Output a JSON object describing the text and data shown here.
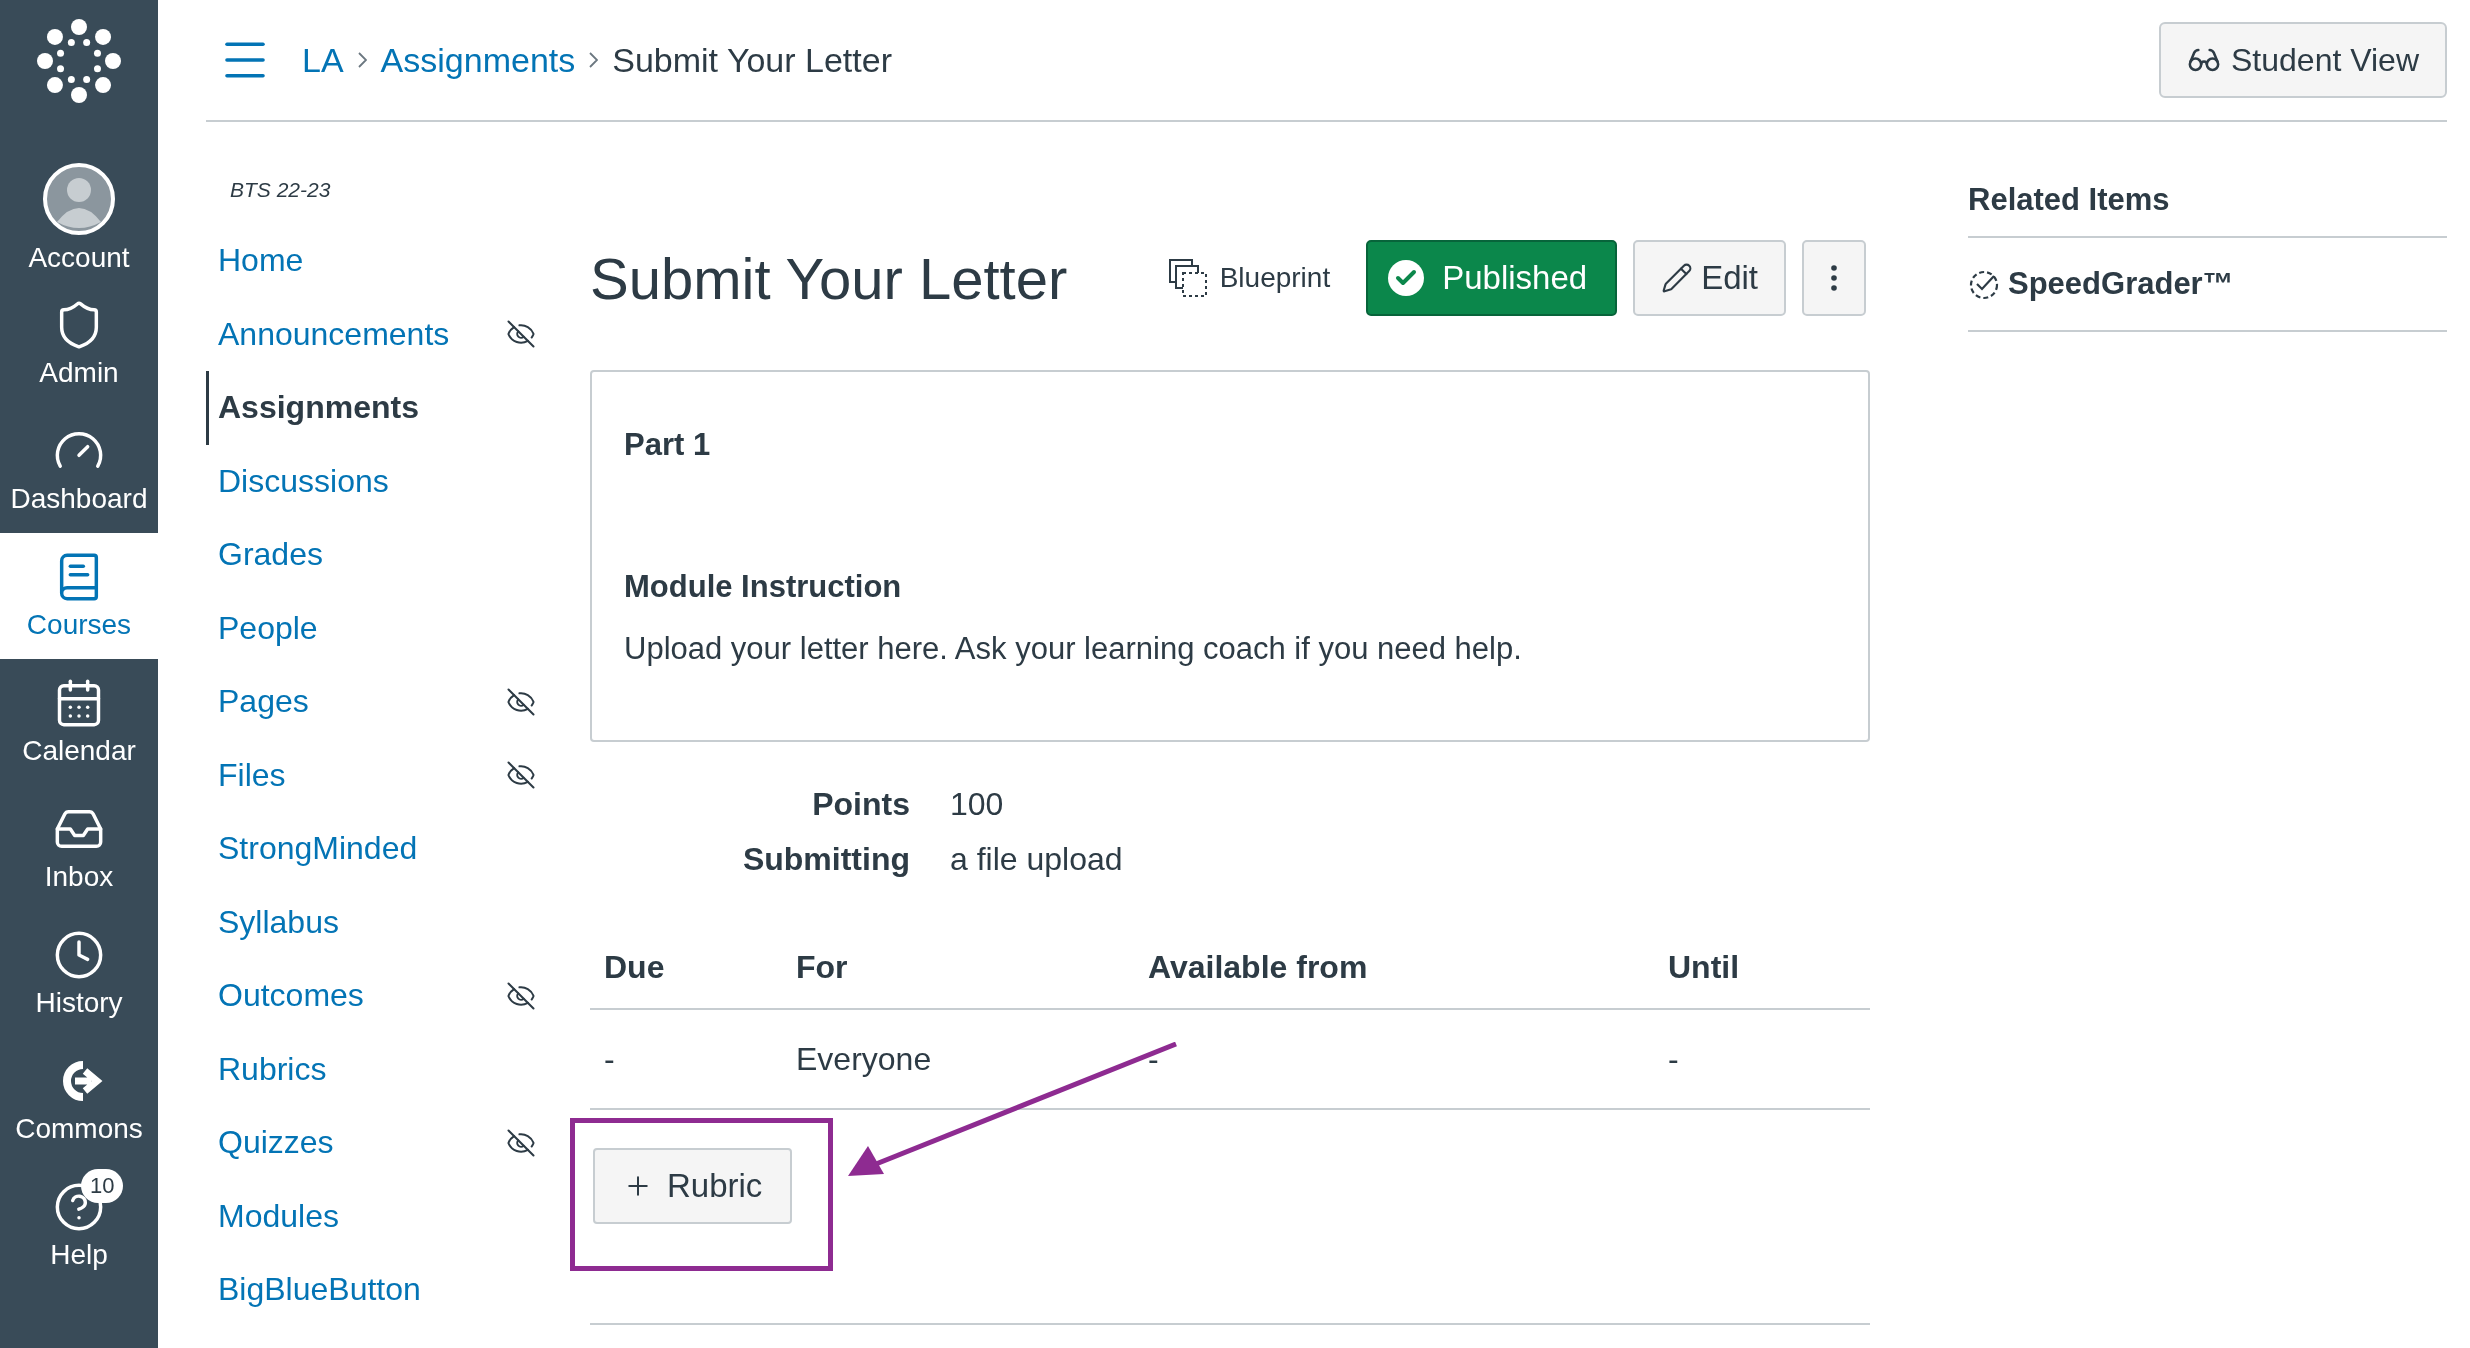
{
  "global_nav": {
    "items": [
      {
        "label": "Account",
        "selected": false
      },
      {
        "label": "Admin",
        "selected": false
      },
      {
        "label": "Dashboard",
        "selected": false
      },
      {
        "label": "Courses",
        "selected": true
      },
      {
        "label": "Calendar",
        "selected": false
      },
      {
        "label": "Inbox",
        "selected": false
      },
      {
        "label": "History",
        "selected": false
      },
      {
        "label": "Commons",
        "selected": false
      },
      {
        "label": "Help",
        "selected": false,
        "badge": "10"
      }
    ]
  },
  "breadcrumb": [
    "LA",
    "Assignments",
    "Submit Your Letter"
  ],
  "student_view_button": "Student View",
  "course_nav": {
    "term": "BTS 22-23",
    "items": [
      {
        "label": "Home",
        "selected": false,
        "hidden": false
      },
      {
        "label": "Announcements",
        "selected": false,
        "hidden": true
      },
      {
        "label": "Assignments",
        "selected": true,
        "hidden": false
      },
      {
        "label": "Discussions",
        "selected": false,
        "hidden": false
      },
      {
        "label": "Grades",
        "selected": false,
        "hidden": false
      },
      {
        "label": "People",
        "selected": false,
        "hidden": false
      },
      {
        "label": "Pages",
        "selected": false,
        "hidden": true
      },
      {
        "label": "Files",
        "selected": false,
        "hidden": true
      },
      {
        "label": "StrongMinded",
        "selected": false,
        "hidden": false
      },
      {
        "label": "Syllabus",
        "selected": false,
        "hidden": false
      },
      {
        "label": "Outcomes",
        "selected": false,
        "hidden": true
      },
      {
        "label": "Rubrics",
        "selected": false,
        "hidden": false
      },
      {
        "label": "Quizzes",
        "selected": false,
        "hidden": true
      },
      {
        "label": "Modules",
        "selected": false,
        "hidden": false
      },
      {
        "label": "BigBlueButton",
        "selected": false,
        "hidden": false
      }
    ]
  },
  "assignment": {
    "title": "Submit Your Letter",
    "blueprint": "Blueprint",
    "publish_button": {
      "label": "Published",
      "published": true
    },
    "edit_button": "Edit",
    "description": {
      "heading": "Part 1",
      "subheading": "Module Instruction",
      "text": "Upload your letter here. Ask your learning coach if you need help."
    },
    "details": [
      {
        "label": "Points",
        "value": "100"
      },
      {
        "label": "Submitting",
        "value": "a file upload"
      }
    ],
    "table": {
      "columns": [
        "Due",
        "For",
        "Available from",
        "Until"
      ],
      "rows": [
        [
          "-",
          "Everyone",
          "-",
          "-"
        ]
      ]
    },
    "rubric_button": "Rubric"
  },
  "related_items": {
    "title": "Related Items",
    "items": [
      "SpeedGrader™"
    ]
  }
}
